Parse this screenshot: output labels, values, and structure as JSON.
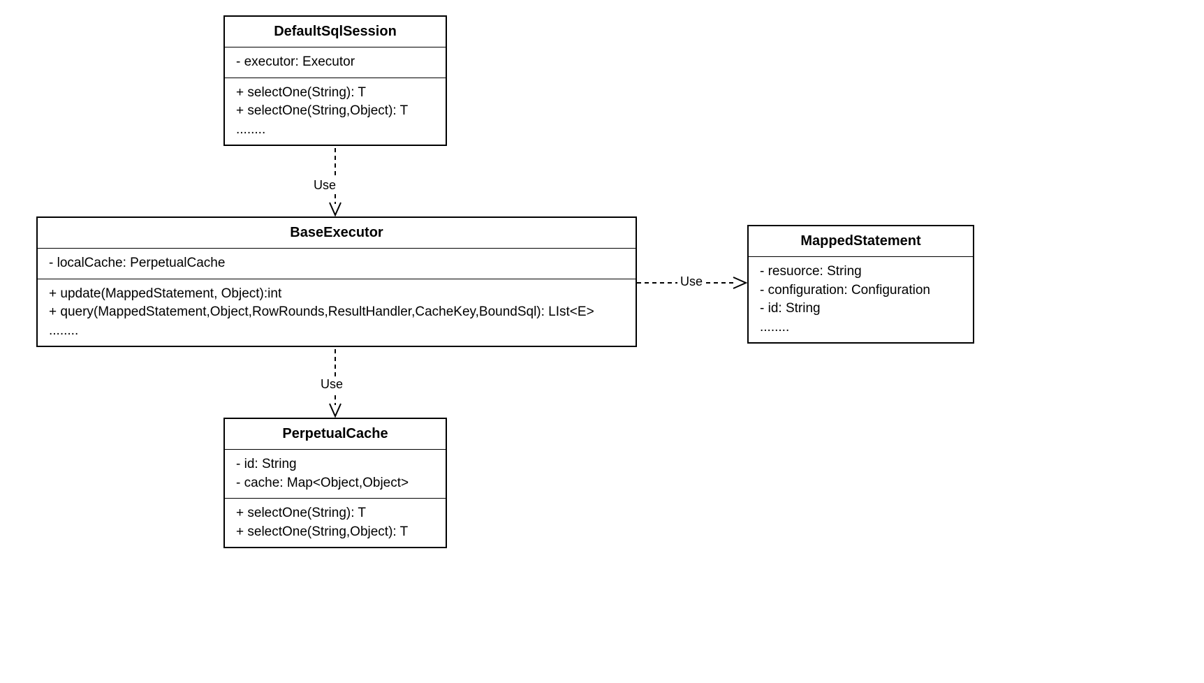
{
  "classes": {
    "defaultSqlSession": {
      "name": "DefaultSqlSession",
      "attrs": [
        "- executor: Executor"
      ],
      "methods": [
        "+ selectOne(String): T",
        "+ selectOne(String,Object): T",
        "........"
      ]
    },
    "baseExecutor": {
      "name": "BaseExecutor",
      "attrs": [
        "- localCache: PerpetualCache"
      ],
      "methods": [
        "+ update(MappedStatement, Object):int",
        "+ query(MappedStatement,Object,RowRounds,ResultHandler,CacheKey,BoundSql): LIst<E>",
        "........"
      ]
    },
    "mappedStatement": {
      "name": "MappedStatement",
      "attrs": [
        "- resuorce: String",
        "- configuration: Configuration",
        "- id: String",
        "........"
      ]
    },
    "perpetualCache": {
      "name": "PerpetualCache",
      "attrs": [
        "- id: String",
        "- cache: Map<Object,Object>"
      ],
      "methods": [
        "+ selectOne(String): T",
        "+ selectOne(String,Object): T"
      ]
    }
  },
  "labels": {
    "use1": "Use",
    "use2": "Use",
    "use3": "Use"
  }
}
